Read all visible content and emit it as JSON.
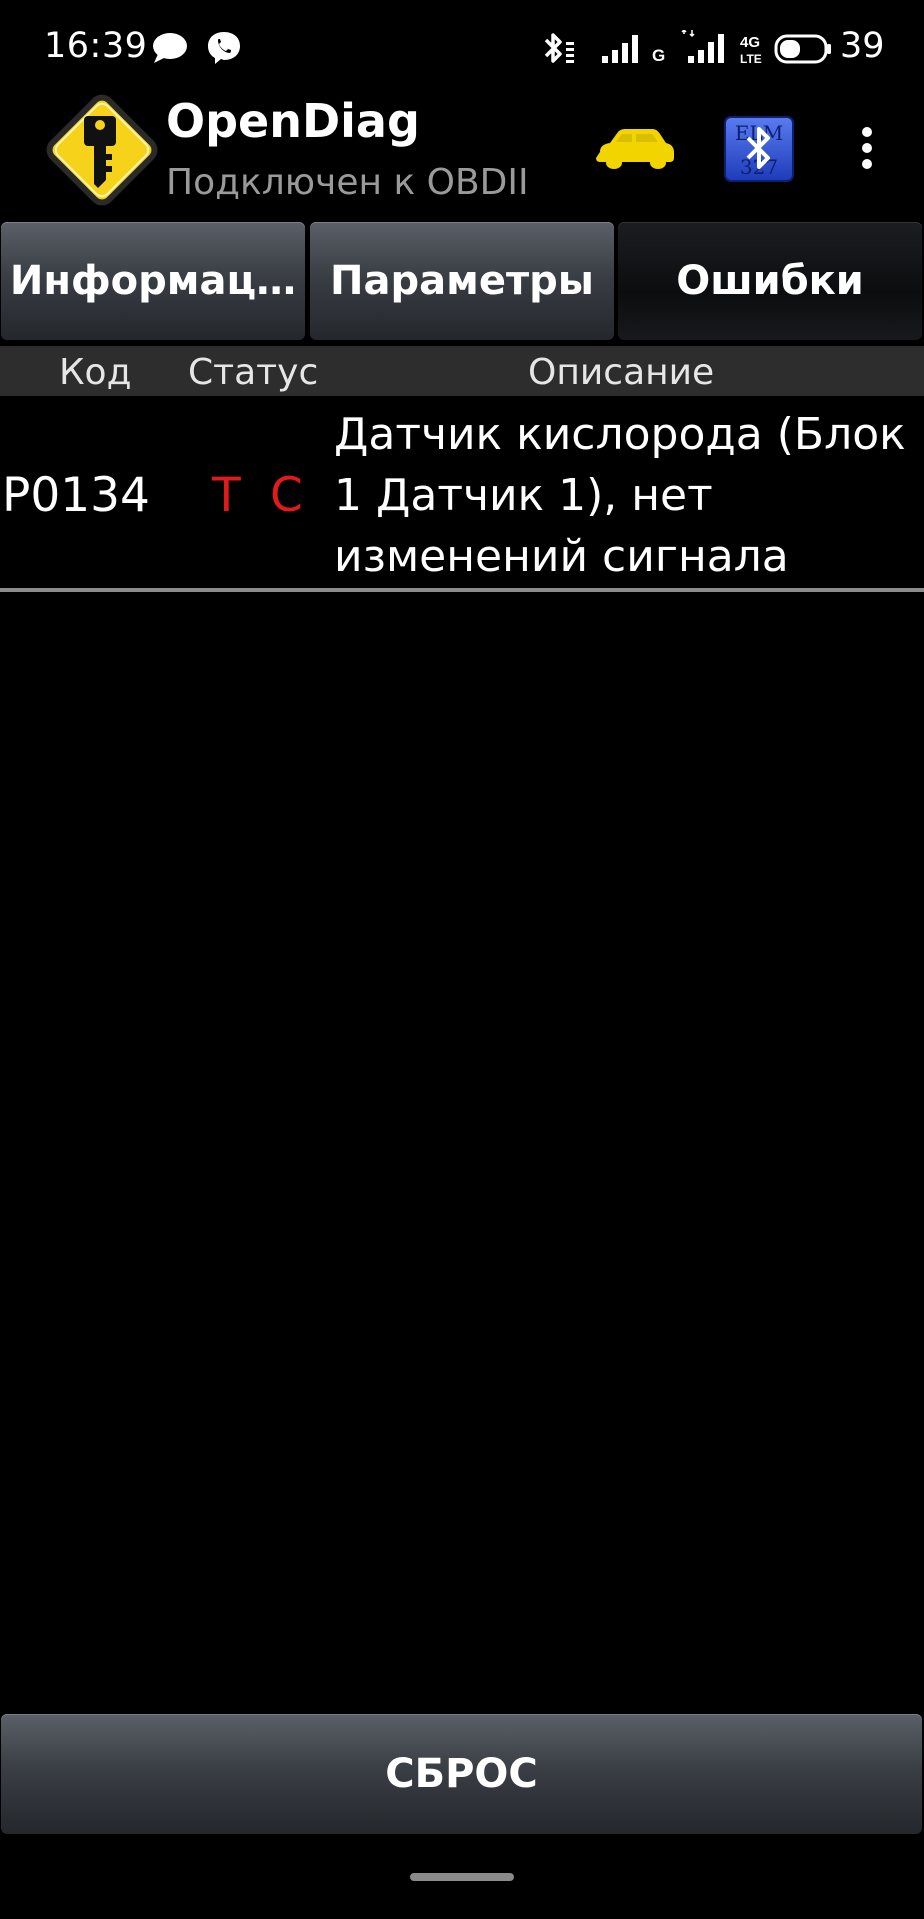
{
  "status_bar": {
    "time": "16:39",
    "battery_level": "39",
    "network_type_1": "G",
    "network_type_2": "4G",
    "network_type_2_sub": "LTE",
    "icons": [
      "chat-bubble-icon",
      "viber-icon",
      "bluetooth-icon",
      "signal-icon",
      "signal-icon",
      "battery-icon"
    ]
  },
  "action_bar": {
    "title": "OpenDiag",
    "subtitle": "Подключен к OBDII",
    "icons": [
      "app-logo-icon",
      "car-icon",
      "elm327-bluetooth-icon",
      "overflow-menu-icon"
    ]
  },
  "tabs": [
    {
      "label": "Информац…",
      "active": false
    },
    {
      "label": "Параметры",
      "active": false
    },
    {
      "label": "Ошибки",
      "active": true
    }
  ],
  "list": {
    "headers": {
      "code": "Код",
      "status": "Статус",
      "description": "Описание"
    },
    "rows": [
      {
        "code": "P0134",
        "status_t": "T",
        "status_c": "C",
        "description": "Датчик кислорода (Блок 1 Датчик 1), нет изменений сигнала"
      }
    ]
  },
  "reset_button": {
    "label": "СБРОС"
  },
  "colors": {
    "background": "#000000",
    "status_flag": "#e01b1b",
    "subtitle": "#9a9a9a",
    "car_icon": "#f2d400",
    "elm_icon": "#2a4fcf"
  }
}
